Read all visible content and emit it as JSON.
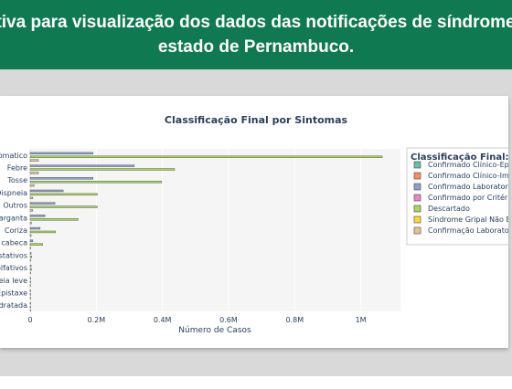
{
  "banner": {
    "line1": "ma interativa para visualização dos dados das notificações de síndrome gripal do",
    "line2": "estado de Pernambuco."
  },
  "chart_data": {
    "type": "bar",
    "orientation": "horizontal",
    "title": "Classificação Final por Sintomas",
    "xlabel": "Número de Casos",
    "ylabel": "",
    "xlim": [
      0,
      1120000
    ],
    "xticks": [
      {
        "value": 0,
        "label": "0"
      },
      {
        "value": 200000,
        "label": "0.2M"
      },
      {
        "value": 400000,
        "label": "0.4M"
      },
      {
        "value": 600000,
        "label": "0.6M"
      },
      {
        "value": 800000,
        "label": "0.8M"
      },
      {
        "value": 1000000,
        "label": "1M"
      }
    ],
    "categories": [
      "ntomatico",
      "Febre",
      "Tosse",
      "Dispneia",
      "Outros",
      "garganta",
      "Coriza",
      "de cabeca",
      "ustativos",
      "olfativos",
      "oneia leve",
      "Epistaxe",
      "sidratada"
    ],
    "series": [
      {
        "name": "Confirmado Clínico-Ep",
        "color": "#66c2a5",
        "values": [
          0,
          0,
          0,
          0,
          0,
          0,
          0,
          0,
          0,
          0,
          0,
          0,
          0
        ]
      },
      {
        "name": "Confirmado Clínico-Im",
        "color": "#fc8d62",
        "values": [
          0,
          0,
          0,
          0,
          0,
          0,
          0,
          0,
          0,
          0,
          0,
          0,
          0
        ]
      },
      {
        "name": "Confirmado Laborator",
        "color": "#8da0cb",
        "values": [
          190000,
          315000,
          190000,
          100000,
          75000,
          45000,
          30000,
          8000,
          3000,
          3000,
          1000,
          1000,
          500
        ]
      },
      {
        "name": "Confirmado por Critéri",
        "color": "#e78ac3",
        "values": [
          0,
          0,
          0,
          0,
          0,
          0,
          0,
          0,
          0,
          0,
          0,
          0,
          0
        ]
      },
      {
        "name": "Descartado",
        "color": "#a6d854",
        "values": [
          1065000,
          437000,
          398000,
          203000,
          203000,
          145000,
          77000,
          38000,
          5000,
          4000,
          1500,
          1500,
          800
        ]
      },
      {
        "name": "Síndrome Gripal Não Es",
        "color": "#ffd92f",
        "values": [
          0,
          0,
          0,
          0,
          0,
          0,
          0,
          0,
          0,
          0,
          0,
          0,
          0
        ]
      },
      {
        "name": "Confirmação Laborato",
        "color": "#e5c494",
        "values": [
          25000,
          25000,
          12000,
          8000,
          8000,
          4000,
          3000,
          1000,
          500,
          500,
          200,
          200,
          100
        ]
      }
    ],
    "legend_title": "Classificação Final:",
    "legend_position": "right",
    "grid": true,
    "plot_bgcolor": "#f5f5f5"
  }
}
